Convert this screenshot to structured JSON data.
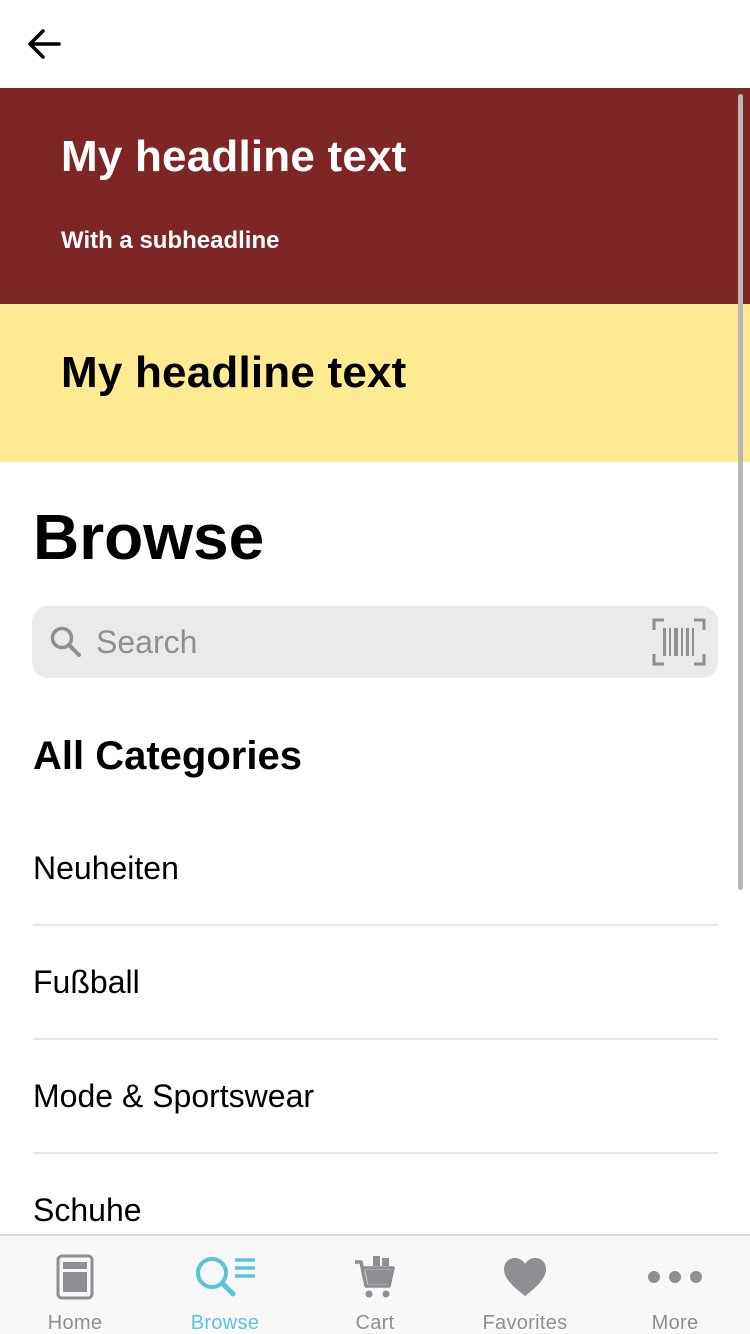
{
  "header": {
    "back_icon": "arrow-left-icon"
  },
  "banners": [
    {
      "headline": "My headline text",
      "subheadline": "With a subheadline",
      "bg_color": "#7e2525",
      "text_color": "#ffffff"
    },
    {
      "headline": "My headline text",
      "bg_color": "#feeb91",
      "text_color": "#000000"
    }
  ],
  "page_title": "Browse",
  "search": {
    "placeholder": "Search",
    "value": "",
    "search_icon": "search-icon",
    "barcode_icon": "barcode-scanner-icon"
  },
  "categories": {
    "title": "All Categories",
    "items": [
      {
        "label": "Neuheiten"
      },
      {
        "label": "Fußball"
      },
      {
        "label": "Mode & Sportswear"
      },
      {
        "label": "Schuhe"
      }
    ]
  },
  "tabbar": {
    "active_color": "#5bc3d8",
    "inactive_color": "#8e8e93",
    "tabs": [
      {
        "label": "Home",
        "icon": "home-icon",
        "active": false
      },
      {
        "label": "Browse",
        "icon": "browse-search-icon",
        "active": true
      },
      {
        "label": "Cart",
        "icon": "cart-icon",
        "active": false
      },
      {
        "label": "Favorites",
        "icon": "heart-icon",
        "active": false
      },
      {
        "label": "More",
        "icon": "more-dots-icon",
        "active": false
      }
    ]
  }
}
